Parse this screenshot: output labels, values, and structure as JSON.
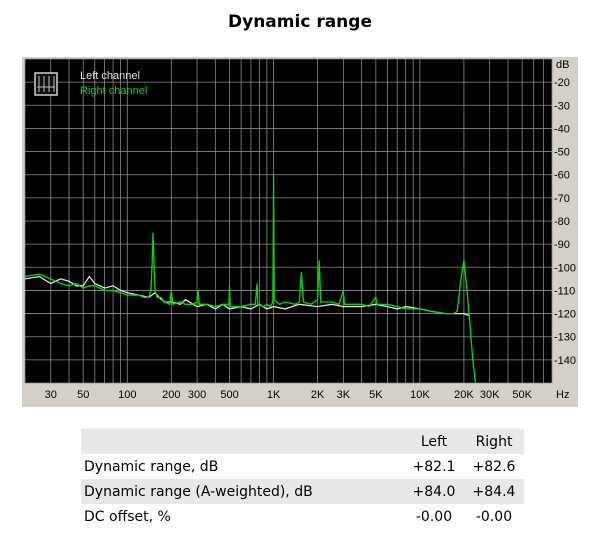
{
  "title": "Dynamic range",
  "chart_data": {
    "type": "line",
    "title": "Dynamic range",
    "x_scale": "log",
    "xlim": [
      20,
      80000
    ],
    "ylim": [
      -150,
      -10
    ],
    "yunit": "dB",
    "xunit": "Hz",
    "grid": true,
    "legend_placement": "top-left",
    "background": "#000000",
    "x_ticks": [
      {
        "v": 30,
        "label": "30"
      },
      {
        "v": 50,
        "label": "50"
      },
      {
        "v": 100,
        "label": "100"
      },
      {
        "v": 200,
        "label": "200"
      },
      {
        "v": 300,
        "label": "300"
      },
      {
        "v": 500,
        "label": "500"
      },
      {
        "v": 1000,
        "label": "1K"
      },
      {
        "v": 2000,
        "label": "2K"
      },
      {
        "v": 3000,
        "label": "3K"
      },
      {
        "v": 5000,
        "label": "5K"
      },
      {
        "v": 10000,
        "label": "10K"
      },
      {
        "v": 20000,
        "label": "20K"
      },
      {
        "v": 30000,
        "label": "30K"
      },
      {
        "v": 50000,
        "label": "50K"
      }
    ],
    "y_ticks": [
      {
        "v": -20,
        "label": "-20"
      },
      {
        "v": -30,
        "label": "-30"
      },
      {
        "v": -40,
        "label": "-40"
      },
      {
        "v": -50,
        "label": "-50"
      },
      {
        "v": -60,
        "label": "-60"
      },
      {
        "v": -70,
        "label": "-70"
      },
      {
        "v": -80,
        "label": "-80"
      },
      {
        "v": -90,
        "label": "-90"
      },
      {
        "v": -100,
        "label": "-100"
      },
      {
        "v": -110,
        "label": "-110"
      },
      {
        "v": -120,
        "label": "-120"
      },
      {
        "v": -130,
        "label": "-130"
      },
      {
        "v": -140,
        "label": "-140"
      }
    ],
    "series": [
      {
        "name": "Left channel",
        "color": "#e0e0e0",
        "points": [
          [
            20,
            -105
          ],
          [
            25,
            -104
          ],
          [
            30,
            -107
          ],
          [
            35,
            -105
          ],
          [
            40,
            -106
          ],
          [
            45,
            -108
          ],
          [
            50,
            -108
          ],
          [
            55,
            -104
          ],
          [
            60,
            -107
          ],
          [
            70,
            -109
          ],
          [
            80,
            -108
          ],
          [
            90,
            -110
          ],
          [
            100,
            -111
          ],
          [
            120,
            -112
          ],
          [
            140,
            -113
          ],
          [
            155,
            -111
          ],
          [
            165,
            -113
          ],
          [
            180,
            -115
          ],
          [
            200,
            -115
          ],
          [
            230,
            -116
          ],
          [
            250,
            -114
          ],
          [
            300,
            -117
          ],
          [
            350,
            -116
          ],
          [
            400,
            -118
          ],
          [
            450,
            -116
          ],
          [
            500,
            -118
          ],
          [
            600,
            -117
          ],
          [
            700,
            -118
          ],
          [
            800,
            -116
          ],
          [
            900,
            -118
          ],
          [
            1000,
            -117
          ],
          [
            1200,
            -118
          ],
          [
            1500,
            -116
          ],
          [
            2000,
            -117
          ],
          [
            2500,
            -116
          ],
          [
            3000,
            -117
          ],
          [
            4000,
            -117
          ],
          [
            5000,
            -116
          ],
          [
            6000,
            -117
          ],
          [
            7000,
            -118
          ],
          [
            8000,
            -117
          ],
          [
            10000,
            -118
          ],
          [
            12000,
            -119
          ],
          [
            15000,
            -120
          ],
          [
            18000,
            -120
          ],
          [
            20000,
            -120
          ],
          [
            22000,
            -121
          ]
        ]
      },
      {
        "name": "Right channel",
        "color": "#00dd00",
        "points": [
          [
            20,
            -104
          ],
          [
            25,
            -103
          ],
          [
            30,
            -105
          ],
          [
            35,
            -107
          ],
          [
            40,
            -108
          ],
          [
            45,
            -107
          ],
          [
            50,
            -109
          ],
          [
            55,
            -108
          ],
          [
            60,
            -108
          ],
          [
            70,
            -110
          ],
          [
            80,
            -110
          ],
          [
            90,
            -111
          ],
          [
            100,
            -112
          ],
          [
            120,
            -112
          ],
          [
            130,
            -113
          ],
          [
            140,
            -113
          ],
          [
            145,
            -110
          ],
          [
            148,
            -98
          ],
          [
            150,
            -85
          ],
          [
            152,
            -97
          ],
          [
            155,
            -110
          ],
          [
            160,
            -113
          ],
          [
            170,
            -113
          ],
          [
            180,
            -115
          ],
          [
            195,
            -116
          ],
          [
            200,
            -110
          ],
          [
            205,
            -116
          ],
          [
            230,
            -115
          ],
          [
            250,
            -116
          ],
          [
            280,
            -116
          ],
          [
            300,
            -115
          ],
          [
            305,
            -110
          ],
          [
            310,
            -116
          ],
          [
            350,
            -116
          ],
          [
            400,
            -117
          ],
          [
            450,
            -116
          ],
          [
            495,
            -116
          ],
          [
            500,
            -108
          ],
          [
            505,
            -117
          ],
          [
            600,
            -117
          ],
          [
            700,
            -116
          ],
          [
            750,
            -116
          ],
          [
            770,
            -107
          ],
          [
            780,
            -116
          ],
          [
            850,
            -117
          ],
          [
            900,
            -116
          ],
          [
            950,
            -117
          ],
          [
            990,
            -115
          ],
          [
            1000,
            -60
          ],
          [
            1010,
            -114
          ],
          [
            1100,
            -116
          ],
          [
            1200,
            -115
          ],
          [
            1400,
            -116
          ],
          [
            1500,
            -115
          ],
          [
            1550,
            -102
          ],
          [
            1600,
            -115
          ],
          [
            1800,
            -116
          ],
          [
            2000,
            -114
          ],
          [
            2050,
            -97
          ],
          [
            2100,
            -115
          ],
          [
            2500,
            -115
          ],
          [
            2800,
            -116
          ],
          [
            3000,
            -110
          ],
          [
            3050,
            -116
          ],
          [
            3500,
            -116
          ],
          [
            4000,
            -116
          ],
          [
            4500,
            -117
          ],
          [
            5000,
            -113
          ],
          [
            5100,
            -116
          ],
          [
            6000,
            -116
          ],
          [
            7000,
            -117
          ],
          [
            8000,
            -118
          ],
          [
            10000,
            -118
          ],
          [
            12000,
            -119
          ],
          [
            15000,
            -120
          ],
          [
            17000,
            -120
          ],
          [
            18000,
            -119
          ],
          [
            19000,
            -106
          ],
          [
            20000,
            -97
          ],
          [
            21000,
            -110
          ],
          [
            22000,
            -125
          ],
          [
            23000,
            -140
          ],
          [
            24000,
            -150
          ]
        ]
      }
    ]
  },
  "table": {
    "headers": [
      "",
      "Left",
      "Right"
    ],
    "rows": [
      {
        "label": "Dynamic range, dB",
        "left": "+82.1",
        "right": "+82.6"
      },
      {
        "label": "Dynamic range (A-weighted), dB",
        "left": "+84.0",
        "right": "+84.4"
      },
      {
        "label": "DC offset, %",
        "left": "-0.00",
        "right": "-0.00"
      }
    ]
  }
}
